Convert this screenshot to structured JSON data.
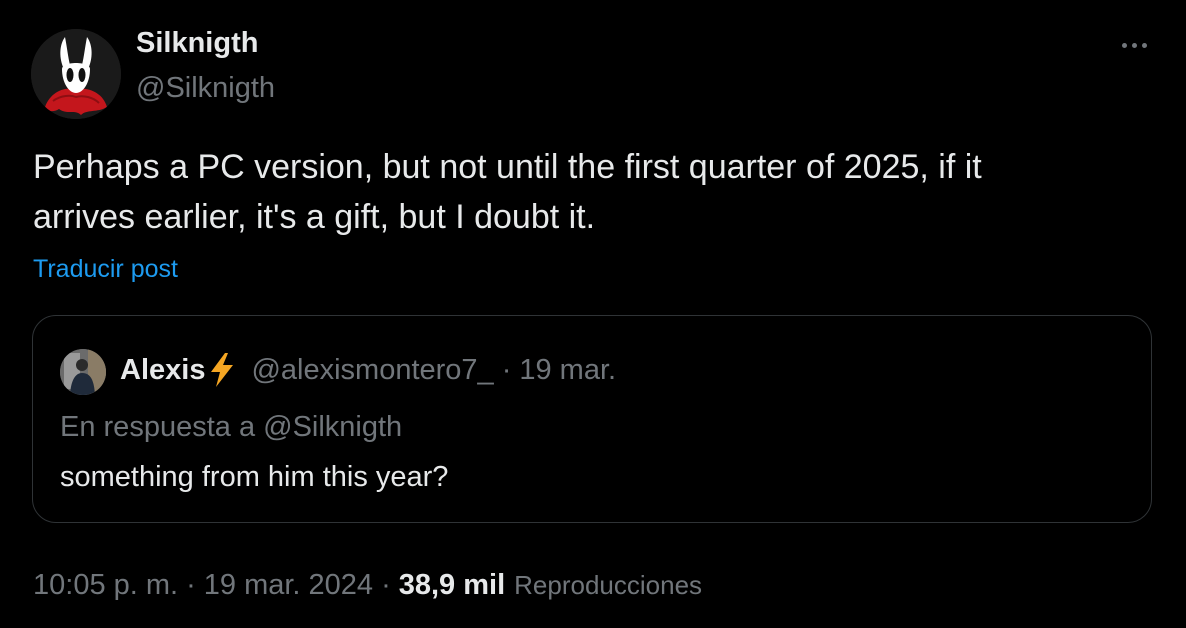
{
  "post": {
    "author": {
      "display_name": "Silknigth",
      "handle": "@Silknigth",
      "avatar_icon": "hornet-character-avatar"
    },
    "more_icon": "more-dots-icon",
    "text_line_1": "Perhaps a PC version, but not until the first quarter of 2025, if it",
    "text_line_2": "arrives earlier, it's a gift, but I doubt it.",
    "translate_label": "Traducir post",
    "link_color": "#1d9bf0"
  },
  "quote": {
    "display_name": "Alexis",
    "name_emoji_icon": "lightning-bolt-icon",
    "handle": "@alexismontero7_",
    "separator": "·",
    "date": "19 mar.",
    "reply_to": "En respuesta a @Silknigth",
    "text": "something from him this year?"
  },
  "meta": {
    "time": "10:05 p. m.",
    "separator": "·",
    "date": "19 mar. 2024",
    "views_count": "38,9 mil",
    "views_label": "Reproducciones"
  }
}
